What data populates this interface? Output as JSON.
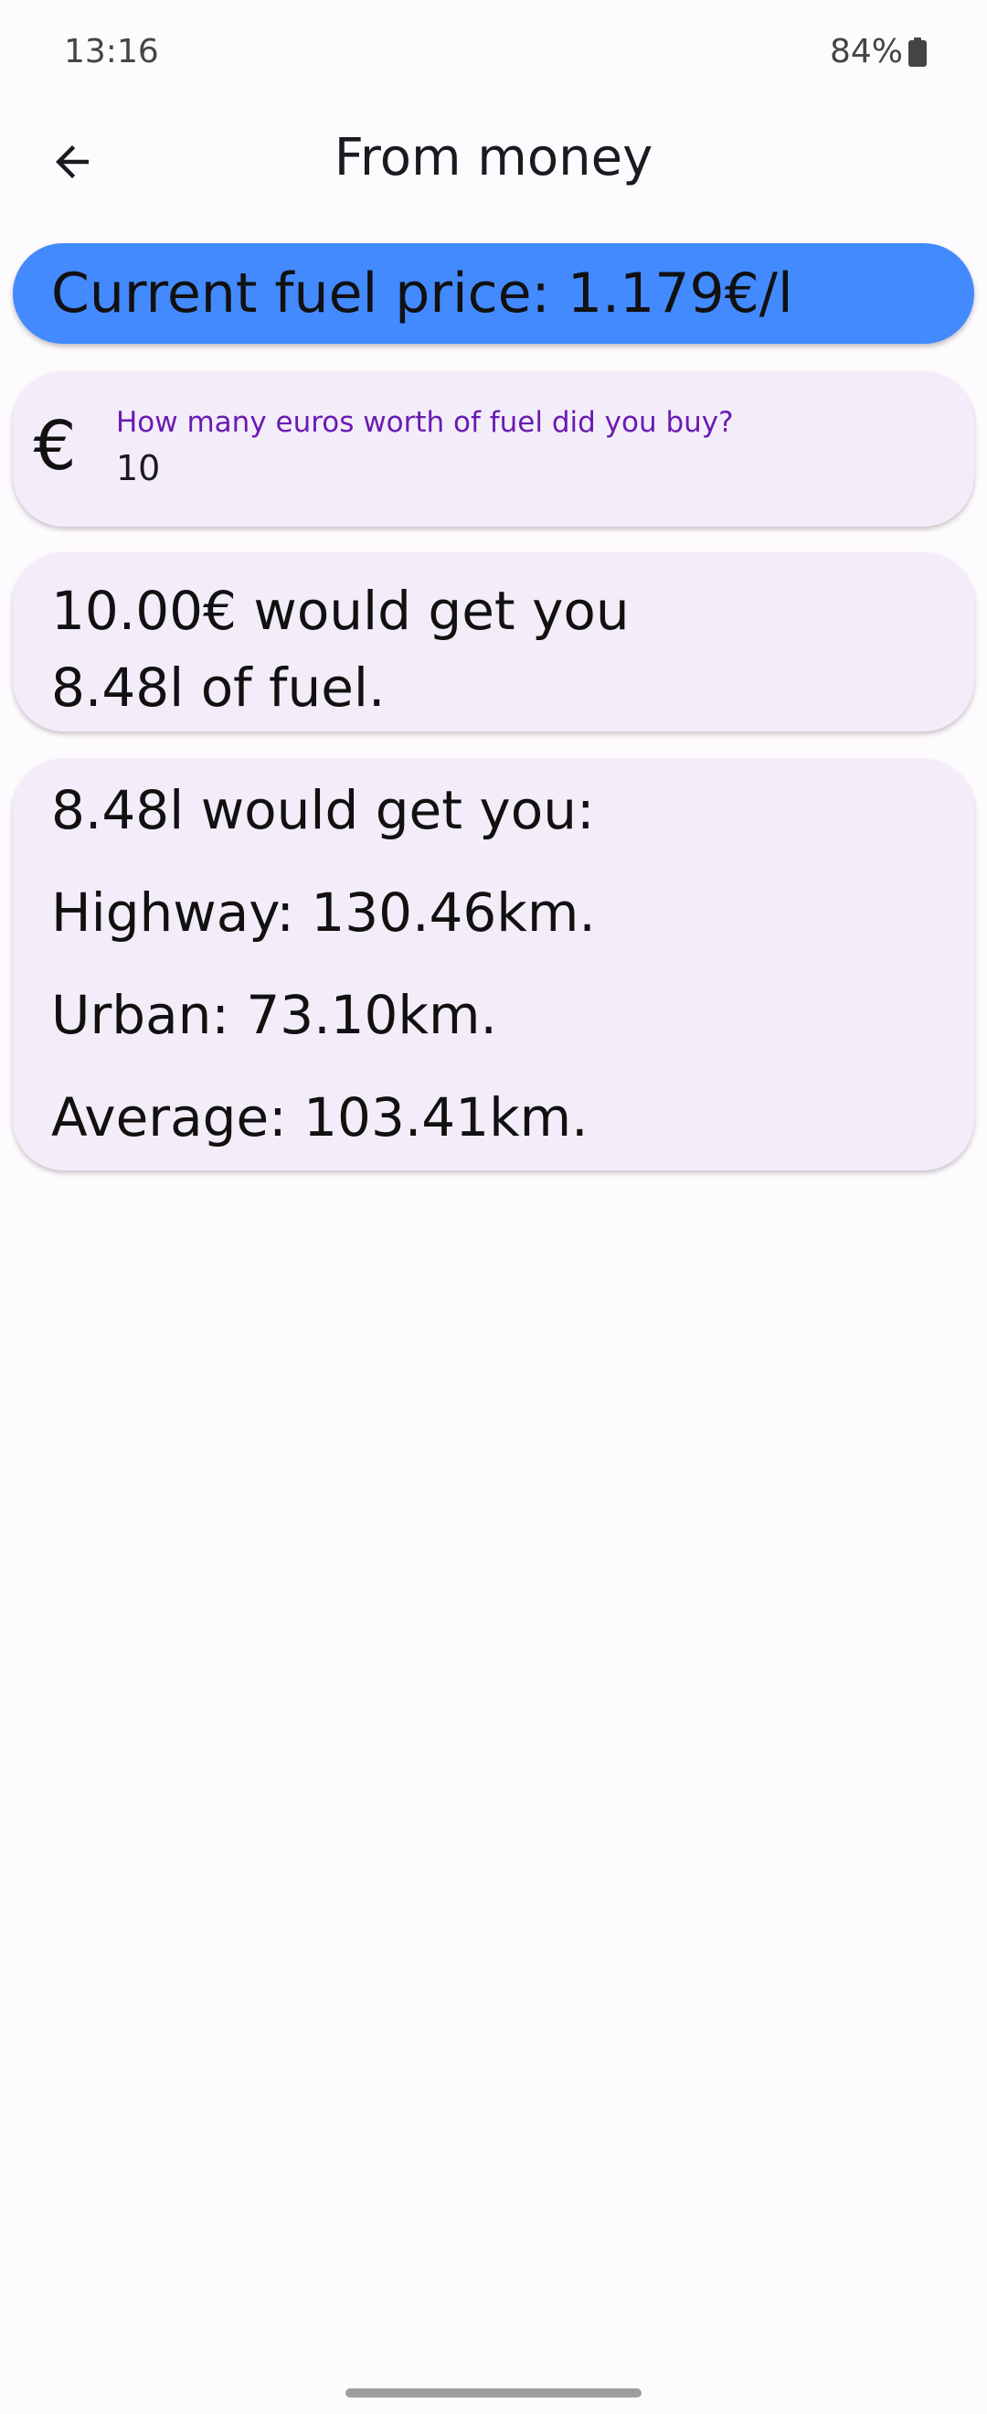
{
  "status_bar": {
    "time": "13:16",
    "battery": "84%",
    "battery_icon": "battery-icon"
  },
  "app_bar": {
    "title": "From money",
    "back_icon": "arrow-left-icon"
  },
  "price_banner": {
    "text": "Current fuel price: 1.179€/l",
    "color": "#448aff"
  },
  "input": {
    "icon": "euro-icon",
    "icon_glyph": "€",
    "label": "How many euros worth of fuel did you buy?",
    "value": "10",
    "label_color": "#6a1bb3"
  },
  "result": {
    "line1": "10.00€ would get you",
    "line2": "8.48l of fuel."
  },
  "distances": {
    "header": "8.48l would get you:",
    "highway": "Highway: 130.46km.",
    "urban": "Urban: 73.10km.",
    "average": "Average: 103.41km."
  },
  "colors": {
    "background": "#fefbff",
    "card": "#f3edfa"
  }
}
